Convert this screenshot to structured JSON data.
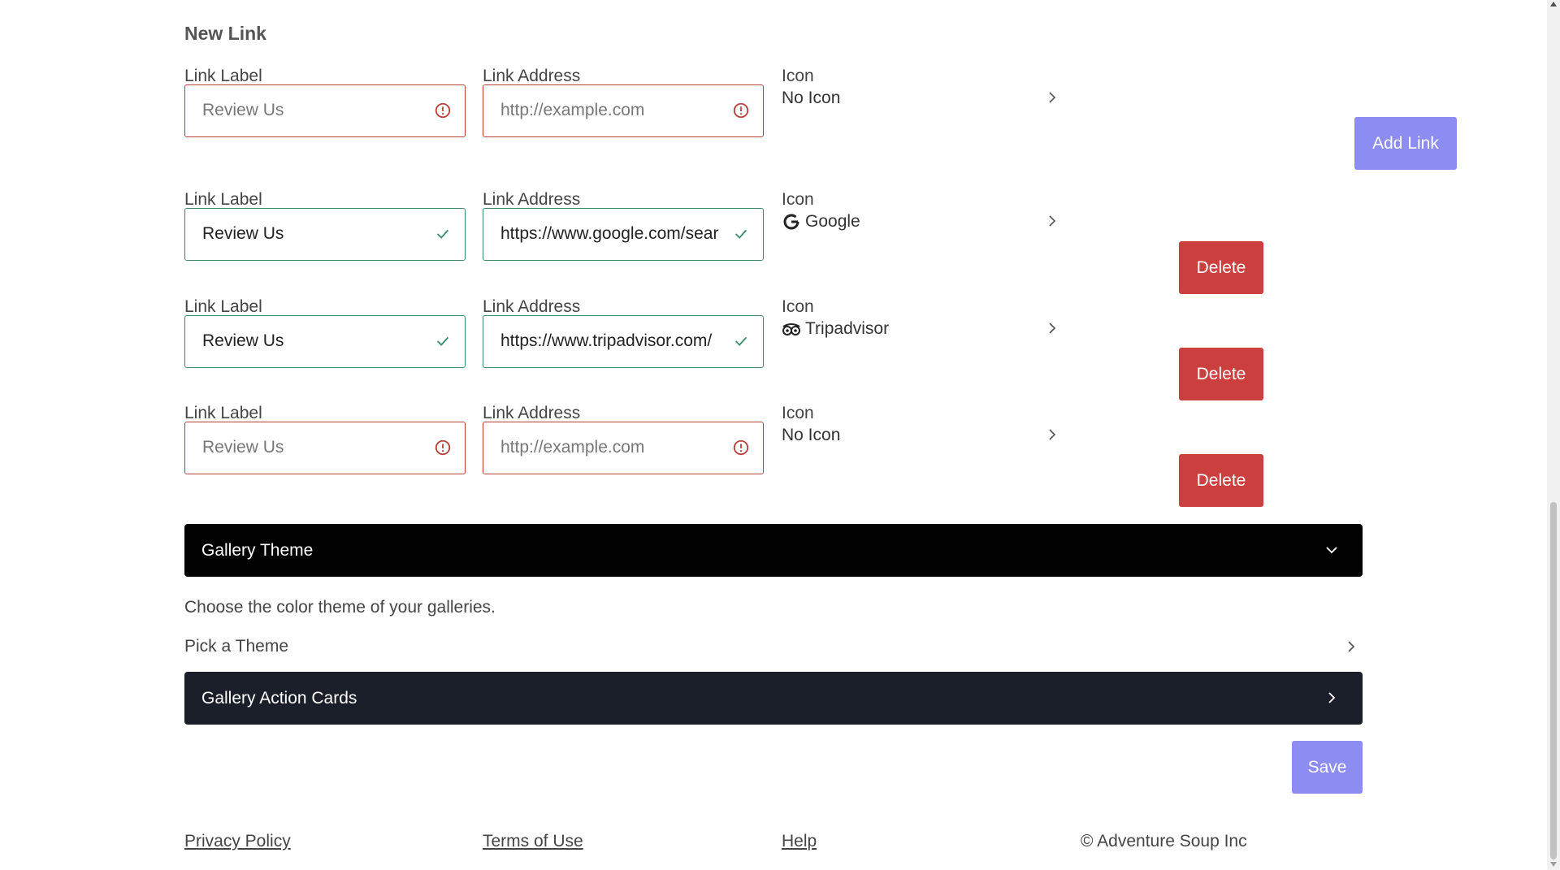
{
  "new_link": {
    "title": "New Link",
    "label_heading": "Link Label",
    "label_placeholder": "Review Us",
    "address_heading": "Link Address",
    "address_placeholder": "http://example.com",
    "icon_heading": "Icon",
    "icon_value": "No Icon",
    "add_button": "Add Link"
  },
  "links": [
    {
      "label_heading": "Link Label",
      "label_value": "Review Us",
      "label_placeholder": "Review Us",
      "address_heading": "Link Address",
      "address_value": "https://www.google.com/sear",
      "address_placeholder": "http://example.com",
      "icon_heading": "Icon",
      "icon_value": "Google",
      "icon_name": "google-icon",
      "delete_button": "Delete"
    },
    {
      "label_heading": "Link Label",
      "label_value": "Review Us",
      "label_placeholder": "Review Us",
      "address_heading": "Link Address",
      "address_value": "https://www.tripadvisor.com/",
      "address_placeholder": "http://example.com",
      "icon_heading": "Icon",
      "icon_value": "Tripadvisor",
      "icon_name": "tripadvisor-icon",
      "delete_button": "Delete"
    },
    {
      "label_heading": "Link Label",
      "label_value": "",
      "label_placeholder": "Review Us",
      "address_heading": "Link Address",
      "address_value": "",
      "address_placeholder": "http://example.com",
      "icon_heading": "Icon",
      "icon_value": "No Icon",
      "icon_name": "",
      "delete_button": "Delete"
    }
  ],
  "gallery_theme": {
    "title": "Gallery Theme",
    "description": "Choose the color theme of your galleries.",
    "picker_label": "Pick a Theme"
  },
  "gallery_action_cards": {
    "title": "Gallery Action Cards"
  },
  "save_button": "Save",
  "footer": {
    "privacy": "Privacy Policy",
    "terms": "Terms of Use",
    "help": "Help",
    "copyright": "© Adventure Soup Inc"
  },
  "colors": {
    "invalid_border": "#b8403c",
    "valid_border": "#3a8c67",
    "add_button_bg": "#8c8cf2",
    "delete_button_bg": "#cc3f3f",
    "gallery_theme_bg": "#020203",
    "gallery_cards_bg": "#1b1f2a"
  }
}
